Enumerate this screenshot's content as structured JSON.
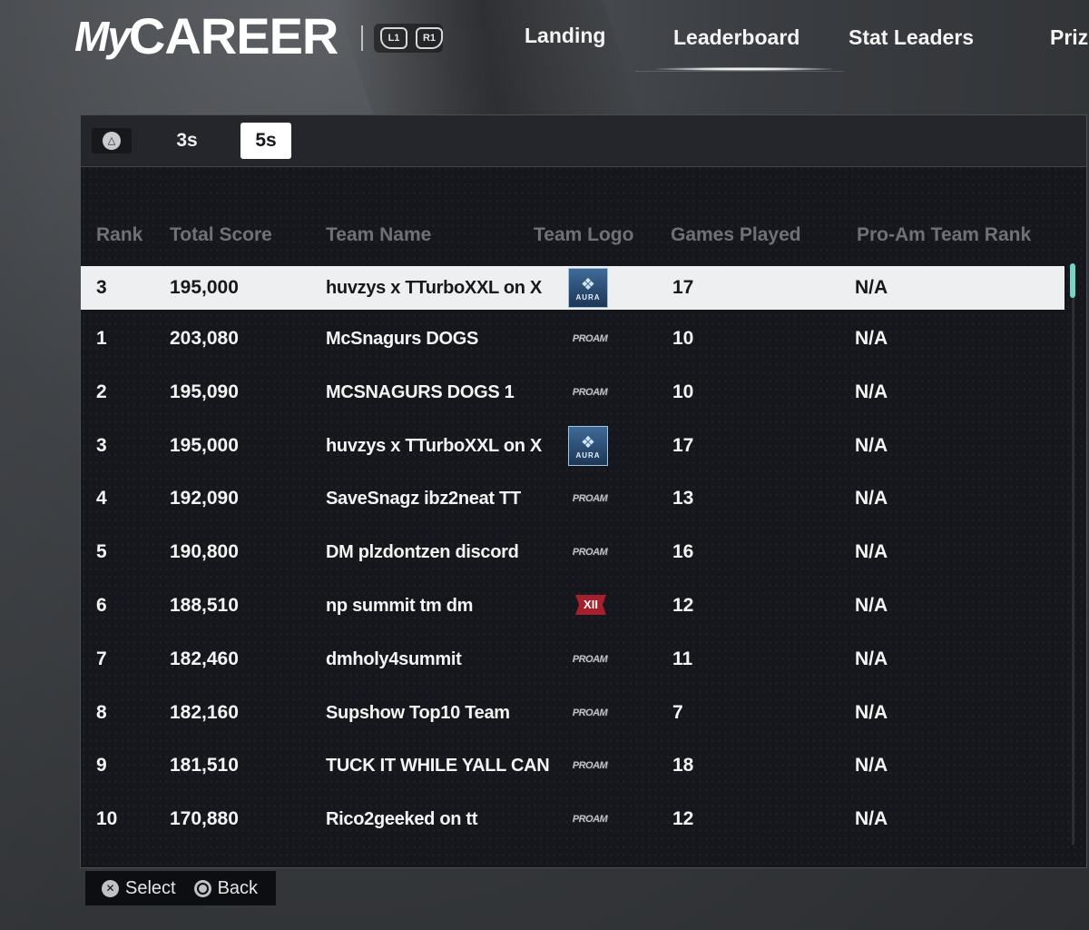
{
  "header": {
    "logo_my": "My",
    "logo_career": "CAREER",
    "bumper_left": "L1",
    "bumper_right": "R1",
    "nav": [
      {
        "label": "Landing"
      },
      {
        "label": "Leaderboard",
        "active": true
      },
      {
        "label": "Stat Leaders"
      },
      {
        "label": "Priz"
      }
    ]
  },
  "tabs": {
    "triangle_icon": "triangle-icon",
    "items": [
      {
        "label": "3s",
        "active": false
      },
      {
        "label": "5s",
        "active": true
      }
    ]
  },
  "table": {
    "columns": [
      "Rank",
      "Total Score",
      "Team Name",
      "Team Logo",
      "Games Played",
      "Pro-Am Team Rank"
    ],
    "selected_row": {
      "rank": "3",
      "score": "195,000",
      "name": "huvzys x TTurboXXL on X",
      "logo": "aura",
      "games": "17",
      "proam_rank": "N/A"
    },
    "rows": [
      {
        "rank": "1",
        "score": "203,080",
        "name": "McSnagurs DOGS",
        "logo": "proam",
        "games": "10",
        "proam_rank": "N/A"
      },
      {
        "rank": "2",
        "score": "195,090",
        "name": "MCSNAGURS DOGS 1",
        "logo": "proam",
        "games": "10",
        "proam_rank": "N/A"
      },
      {
        "rank": "3",
        "score": "195,000",
        "name": "huvzys x TTurboXXL on X",
        "logo": "aura",
        "games": "17",
        "proam_rank": "N/A"
      },
      {
        "rank": "4",
        "score": "192,090",
        "name": "SaveSnagz ibz2neat TT",
        "logo": "proam",
        "games": "13",
        "proam_rank": "N/A"
      },
      {
        "rank": "5",
        "score": "190,800",
        "name": "DM plzdontzen discord",
        "logo": "proam",
        "games": "16",
        "proam_rank": "N/A"
      },
      {
        "rank": "6",
        "score": "188,510",
        "name": "np summit tm dm",
        "logo": "xii",
        "games": "12",
        "proam_rank": "N/A"
      },
      {
        "rank": "7",
        "score": "182,460",
        "name": "dmholy4summit",
        "logo": "proam",
        "games": "11",
        "proam_rank": "N/A"
      },
      {
        "rank": "8",
        "score": "182,160",
        "name": "Supshow Top10 Team",
        "logo": "proam",
        "games": "7",
        "proam_rank": "N/A"
      },
      {
        "rank": "9",
        "score": "181,510",
        "name": "TUCK IT WHILE YALL CAN",
        "logo": "proam",
        "games": "18",
        "proam_rank": "N/A"
      },
      {
        "rank": "10",
        "score": "170,880",
        "name": "Rico2geeked on tt",
        "logo": "proam",
        "games": "12",
        "proam_rank": "N/A"
      }
    ],
    "logo_texts": {
      "aura": "AURA",
      "proam": "PROAM",
      "xii": "XII"
    }
  },
  "footer": {
    "select_icon": "cross-button-icon",
    "select_label": "Select",
    "back_icon": "circle-button-icon",
    "back_label": "Back"
  },
  "colors": {
    "accent": "#73d6c4",
    "selected_row": "#eeeff0",
    "header_text": "#6e7277",
    "xii_red": "#a4202c"
  }
}
